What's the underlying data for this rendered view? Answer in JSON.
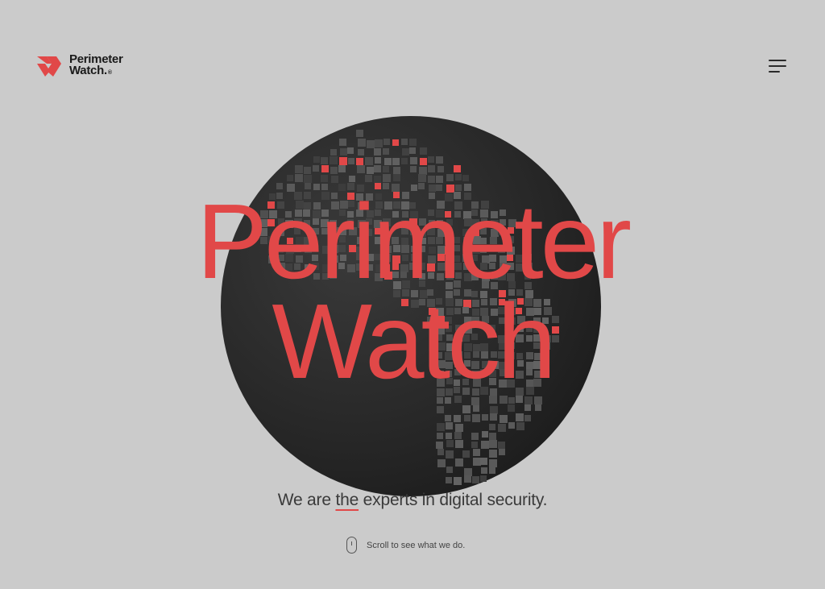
{
  "header": {
    "logo_line1": "Perimeter",
    "logo_line2": "Watch.",
    "logo_registered": "®",
    "logo_icon": "perimeter-watch-logo-icon",
    "menu_icon": "hamburger-menu-icon"
  },
  "hero": {
    "title_line1": "Perimeter",
    "title_line2": "Watch",
    "globe_icon": "pixel-globe-graphic"
  },
  "tagline": {
    "before": "We are ",
    "emphasis": "the",
    "after": " experts in digital security."
  },
  "scroll": {
    "icon": "mouse-scroll-icon",
    "text": "Scroll to see what we do."
  },
  "colors": {
    "background": "#cbcbcb",
    "accent": "#e14848",
    "globe": "#2b2b2b",
    "text": "#3a3a3a"
  }
}
